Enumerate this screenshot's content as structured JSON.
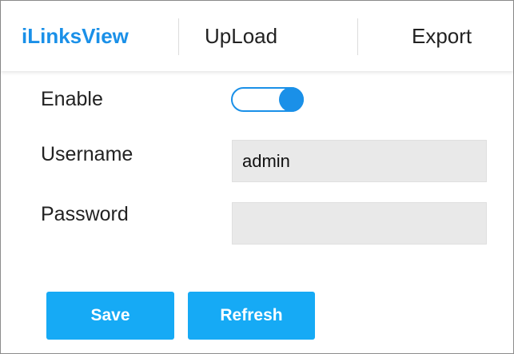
{
  "tabs": [
    {
      "label": "iLinksView",
      "active": true
    },
    {
      "label": "UpLoad",
      "active": false
    },
    {
      "label": "Export",
      "active": false
    }
  ],
  "form": {
    "enable_label": "Enable",
    "enable_value": true,
    "username_label": "Username",
    "username_value": "admin",
    "password_label": "Password",
    "password_value": ""
  },
  "buttons": {
    "save_label": "Save",
    "refresh_label": "Refresh"
  },
  "colors": {
    "accent": "#1a90e8",
    "button": "#16aaf5",
    "field_bg": "#e9e9e9"
  }
}
